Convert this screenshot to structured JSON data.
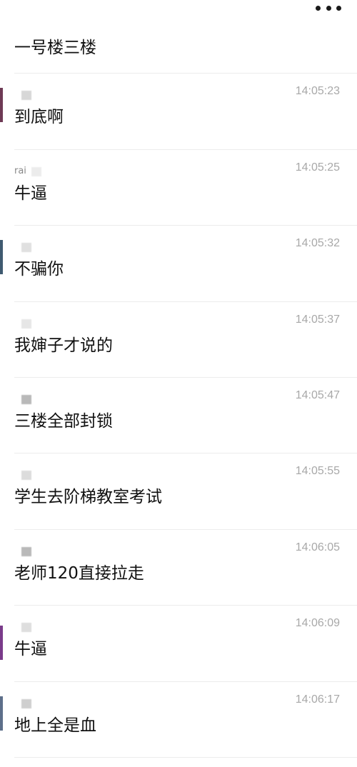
{
  "header": {
    "more_icon": "more-horizontal-icon"
  },
  "first_message": {
    "text": "一号楼三楼"
  },
  "messages": [
    {
      "sender": "",
      "time": "14:05:23",
      "text": "到底啊"
    },
    {
      "sender": "rai",
      "time": "14:05:25",
      "text": "牛逼"
    },
    {
      "sender": "",
      "time": "14:05:32",
      "text": "不骗你"
    },
    {
      "sender": "",
      "time": "14:05:37",
      "text": "我婶子才说的"
    },
    {
      "sender": "",
      "time": "14:05:47",
      "text": "三楼全部封锁"
    },
    {
      "sender": "",
      "time": "14:05:55",
      "text": "学生去阶梯教室考试"
    },
    {
      "sender": "",
      "time": "14:06:05",
      "text": "老师120直接拉走"
    },
    {
      "sender": "",
      "time": "14:06:09",
      "text": "牛逼"
    },
    {
      "sender": "",
      "time": "14:06:17",
      "text": "地上全是血"
    }
  ]
}
